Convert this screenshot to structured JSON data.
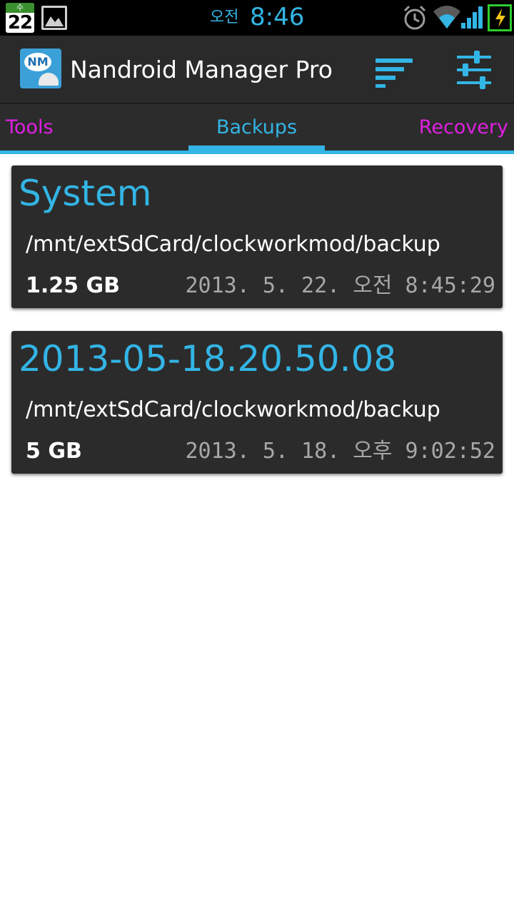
{
  "status_bar": {
    "calendar_weekday": "수",
    "calendar_day": "22",
    "ampm": "오전",
    "time": "8:46",
    "icons": [
      "calendar-icon",
      "gallery-icon",
      "alarm-icon",
      "wifi-icon",
      "signal-icon",
      "battery-charging-icon"
    ]
  },
  "action_bar": {
    "app_logo_text": "NM",
    "title": "Nandroid Manager Pro",
    "actions": [
      "sort-icon",
      "settings-sliders-icon"
    ]
  },
  "tabs": [
    {
      "label": "Tools",
      "selected": false
    },
    {
      "label": "Backups",
      "selected": true
    },
    {
      "label": "Recovery",
      "selected": false
    }
  ],
  "backups": [
    {
      "name": "System",
      "path": "/mnt/extSdCard/clockworkmod/backup",
      "size": "1.25 GB",
      "date": "2013. 5. 22. 오전 8:45:29"
    },
    {
      "name": "2013-05-18.20.50.08",
      "path": "/mnt/extSdCard/clockworkmod/backup",
      "size": "5 GB",
      "date": "2013. 5. 18. 오후 9:02:52"
    }
  ],
  "colors": {
    "accent": "#33b5e5",
    "inactive_tab": "#e020e0",
    "card_bg": "#2b2b2b",
    "actionbar_bg": "#2a2a2a",
    "date_text": "#a8a8a8"
  }
}
